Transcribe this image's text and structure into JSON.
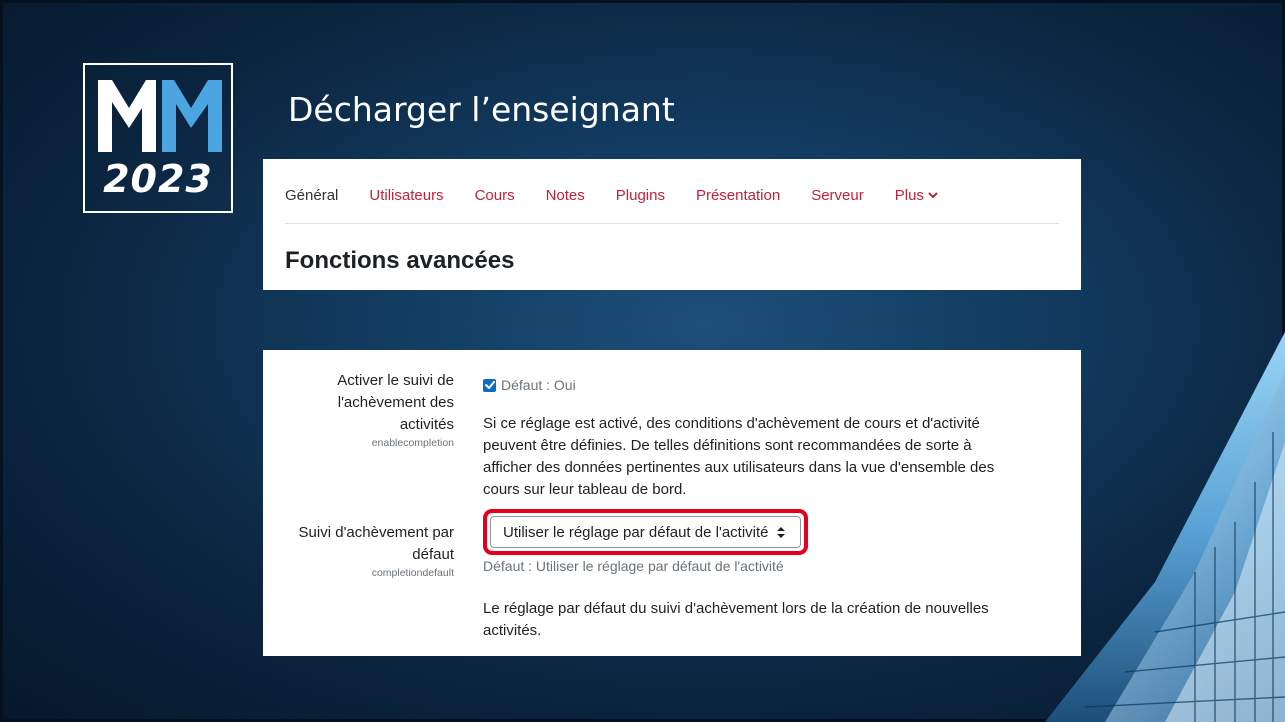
{
  "slide": {
    "title": "Décharger l’enseignant",
    "logo": {
      "letters": "MM",
      "year": "2023"
    }
  },
  "nav": {
    "tabs": [
      {
        "label": "Général",
        "active": true
      },
      {
        "label": "Utilisateurs"
      },
      {
        "label": "Cours"
      },
      {
        "label": "Notes"
      },
      {
        "label": "Plugins"
      },
      {
        "label": "Présentation"
      },
      {
        "label": "Serveur"
      },
      {
        "label": "Plus",
        "icon": "chevron-down-icon"
      }
    ]
  },
  "page": {
    "heading": "Fonctions avancées"
  },
  "settings": {
    "enablecompletion": {
      "label_lines": [
        "Activer le suivi de",
        "l'achèvement des",
        "activités"
      ],
      "key": "enablecompletion",
      "checked": true,
      "default_text": "Défaut : Oui",
      "description_lines": [
        "Si ce réglage est activé, des conditions d'achèvement de cours et d'activité",
        "peuvent être définies. De telles définitions sont recommandées de sorte à",
        "afficher des données pertinentes aux utilisateurs dans la vue d'ensemble des",
        "cours sur leur tableau de bord."
      ]
    },
    "completiondefault": {
      "label_lines": [
        "Suivi d'achèvement par",
        "défaut"
      ],
      "key": "completiondefault",
      "selected_value": "Utiliser le réglage par défaut de l'activité",
      "default_text": "Défaut : Utiliser le réglage par défaut de l'activité",
      "description_lines": [
        "Le réglage par défaut du suivi d'achèvement lors de la création de nouvelles",
        "activités."
      ]
    }
  },
  "colors": {
    "accent": "#c7203a",
    "highlight": "#e5001d",
    "checkbox": "#0f6cbf"
  }
}
